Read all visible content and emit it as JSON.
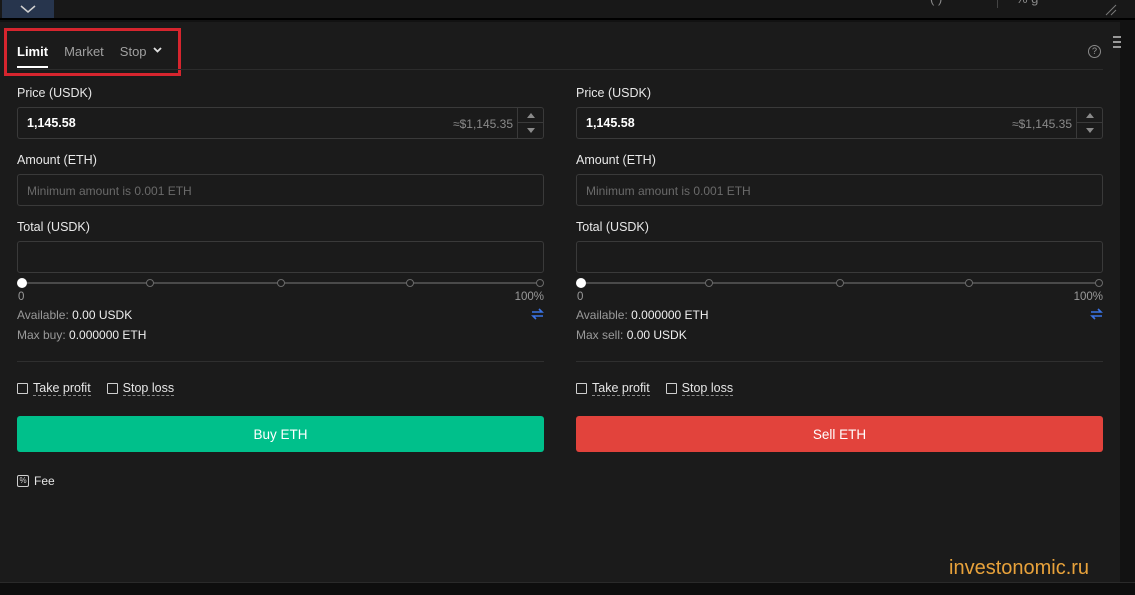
{
  "topbar": {
    "fragment_left": "(     )",
    "fragment_right": "%  g"
  },
  "tabs": [
    {
      "label": "Limit",
      "active": true
    },
    {
      "label": "Market",
      "active": false
    },
    {
      "label": "Stop",
      "active": false
    }
  ],
  "help_icon": "?",
  "buy": {
    "price_label": "Price (USDK)",
    "price_value": "1,145.58",
    "price_approx": "≈$1,145.35",
    "amount_label": "Amount (ETH)",
    "amount_placeholder": "Minimum amount is 0.001 ETH",
    "total_label": "Total (USDK)",
    "slider_min": "0",
    "slider_max": "100%",
    "slider_level": 0,
    "available_label": "Available:",
    "available_value": "0.00 USDK",
    "max_label": "Max buy:",
    "max_value": "0.000000 ETH",
    "take_profit": "Take profit",
    "stop_loss": "Stop loss",
    "button_label": "Buy ETH",
    "button_color": "#00c08b"
  },
  "sell": {
    "price_label": "Price (USDK)",
    "price_value": "1,145.58",
    "price_approx": "≈$1,145.35",
    "amount_label": "Amount (ETH)",
    "amount_placeholder": "Minimum amount is 0.001 ETH",
    "total_label": "Total (USDK)",
    "slider_min": "0",
    "slider_max": "100%",
    "slider_level": 0,
    "available_label": "Available:",
    "available_value": "0.000000 ETH",
    "max_label": "Max sell:",
    "max_value": "0.00 USDK",
    "take_profit": "Take profit",
    "stop_loss": "Stop loss",
    "button_label": "Sell ETH",
    "button_color": "#e2433c"
  },
  "fee": {
    "icon": "%",
    "label": "Fee"
  },
  "watermark": "investonomic.ru",
  "icons": [
    "chevron-down-icon",
    "help-icon",
    "swap-icon",
    "fee-icon",
    "stepper-up-icon",
    "stepper-down-icon"
  ]
}
